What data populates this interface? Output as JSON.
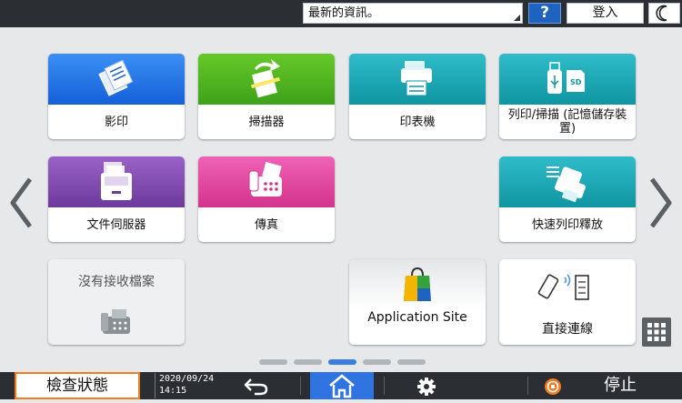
{
  "topbar": {
    "news": "最新的資訊。",
    "help": "?",
    "login": "登入",
    "night_mode_icon": "moon-icon"
  },
  "apps": [
    {
      "label": "影印",
      "color": "#2a7ae8",
      "icon": "copy-icon"
    },
    {
      "label": "掃描器",
      "color": "#52b822",
      "icon": "scanner-icon"
    },
    {
      "label": "印表機",
      "color": "#1aa9b6",
      "icon": "printer-icon"
    },
    {
      "label": "列印/掃描 (記憶儲存裝置)",
      "color": "#1aa9b6",
      "icon": "usb-sd-icon"
    },
    {
      "label": "文件伺服器",
      "color": "#8550b4",
      "icon": "document-server-icon"
    },
    {
      "label": "傳真",
      "color": "#e4479f",
      "icon": "fax-icon"
    },
    {
      "label": "快速列印釋放",
      "color": "#1aa9b6",
      "icon": "quick-print-release-icon"
    },
    {
      "label": "沒有接收檔案",
      "icon": "fax-inbox-icon"
    },
    {
      "label": "Application Site",
      "icon": "application-site-icon"
    },
    {
      "label": "直接連線",
      "icon": "direct-connection-icon"
    }
  ],
  "pager": {
    "count": 5,
    "active": 3
  },
  "bottombar": {
    "status": "檢查狀態",
    "date": "2020/09/24",
    "time": "14:15",
    "stop": "停止",
    "accent": "#f07b20",
    "home_color": "#2f74e0"
  }
}
